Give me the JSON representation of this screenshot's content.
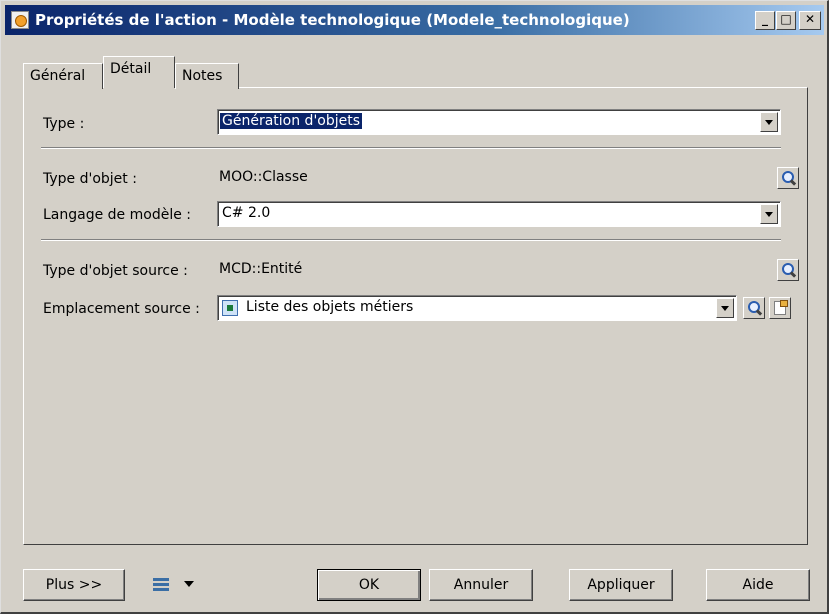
{
  "window": {
    "title": "Propriétés de l'action - Modèle technologique (Modele_technologique)",
    "minimize_glyph": "_",
    "maximize_glyph": "□",
    "close_glyph": "✕"
  },
  "tabs": [
    {
      "label": "Général",
      "active": false
    },
    {
      "label": "Détail",
      "active": true
    },
    {
      "label": "Notes",
      "active": false
    }
  ],
  "detail": {
    "type_label": "Type :",
    "type_value": "Génération d'objets",
    "object_type_label": "Type d'objet :",
    "object_type_value": "MOO::Classe",
    "model_language_label": "Langage de modèle :",
    "model_language_value": "C# 2.0",
    "source_object_type_label": "Type d'objet source :",
    "source_object_type_value": "MCD::Entité",
    "source_location_label": "Emplacement source :",
    "source_location_value": "Liste des objets métiers"
  },
  "footer": {
    "more_label": "Plus >>",
    "ok_label": "OK",
    "cancel_label": "Annuler",
    "apply_label": "Appliquer",
    "help_label": "Aide"
  },
  "icons": {
    "title": "action-icon",
    "properties": "magnifier-icon",
    "open_properties": "properties-icon",
    "list": "list-icon",
    "print": "print-icon"
  }
}
